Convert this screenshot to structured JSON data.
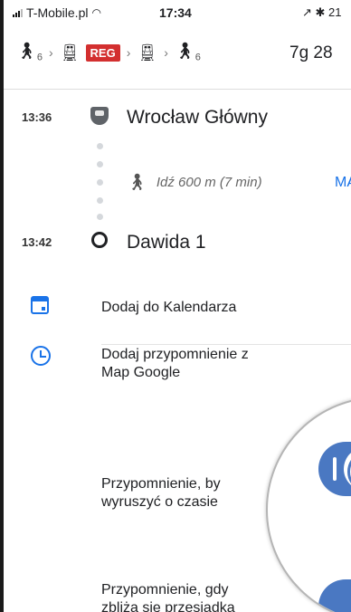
{
  "status_bar": {
    "carrier": "T-Mobile.pl",
    "time": "17:34",
    "right": "↗ ✱ 21"
  },
  "route_header": {
    "walk_index_start": "6",
    "reg_badge": "REG",
    "walk_index_end": "6",
    "duration": "7g 28",
    "colors": {
      "reg_badge": "#d32f2f"
    }
  },
  "timeline": {
    "start": {
      "time": "13:36",
      "name": "Wrocław Główny"
    },
    "walk": {
      "text": "Idź 600 m (7 min)",
      "map_link": "MĄ"
    },
    "end": {
      "time": "13:42",
      "name": "Dawida 1"
    }
  },
  "actions": {
    "calendar": "Dodaj do Kalendarza",
    "reminder_title_line1": "Dodaj przypomnienie z",
    "reminder_title_line2": "Map Google",
    "departure_line1": "Przypomnienie, by",
    "departure_line2": "wyruszyć o czasie",
    "transfer_line1": "Przypomnienie, gdy",
    "transfer_line2": "zbliża się przesiadka"
  },
  "toggles": {
    "departure_reminder": true,
    "transfer_reminder": true
  },
  "icons": [
    "signal-icon",
    "wifi-icon",
    "walk-icon",
    "train-icon",
    "chevron-right-icon",
    "stop-pin-icon",
    "calendar-icon",
    "alarm-clock-icon"
  ],
  "colors": {
    "accent": "#1a73e8",
    "toggle_on": "#4a78c2"
  }
}
